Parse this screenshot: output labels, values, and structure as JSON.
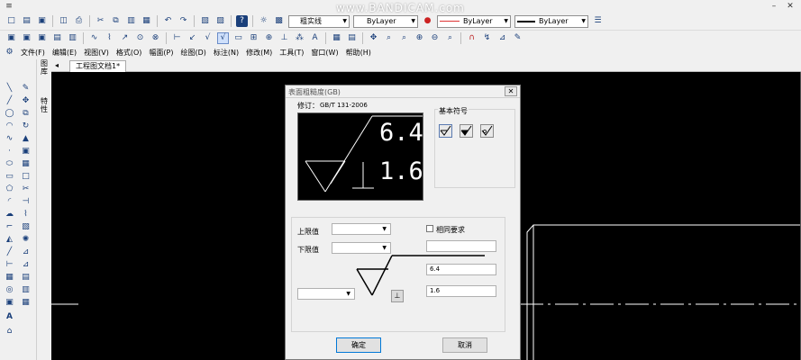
{
  "watermark": "www.BANDICAM.com",
  "toolbar_top": {
    "linetype_combo": "粗实线",
    "layer_combo": "ByLayer",
    "linetype2_combo": "ByLayer",
    "lineweight_combo": "ByLayer"
  },
  "menubar": {
    "items": [
      "文件(F)",
      "编辑(E)",
      "视图(V)",
      "格式(O)",
      "幅面(P)",
      "绘图(D)",
      "标注(N)",
      "修改(M)",
      "工具(T)",
      "窗口(W)",
      "帮助(H)"
    ]
  },
  "left_panel": {
    "label1": "图库",
    "label2": "特性"
  },
  "document_tab": "工程图文档1*",
  "dialog": {
    "title": "表面粗糙度(GB)",
    "revision_label": "修订：",
    "revision_value": "GB/T 131-2006",
    "preview_upper": "6.4",
    "preview_lower": "1.6",
    "basic_symbol_label": "基本符号",
    "upper_limit_label": "上限值",
    "lower_limit_label": "下限值",
    "same_requirement_label": "相同要求",
    "field_upper_value": "6.4",
    "field_lower_value": "1.6",
    "ok_button": "确定",
    "cancel_button": "取消"
  },
  "colors": {
    "canvas": "#000000",
    "dialog_bg": "#f0f0f0",
    "toolbar_icon": "#1a3f7a",
    "layer_color_swatch": "#cc2222"
  }
}
